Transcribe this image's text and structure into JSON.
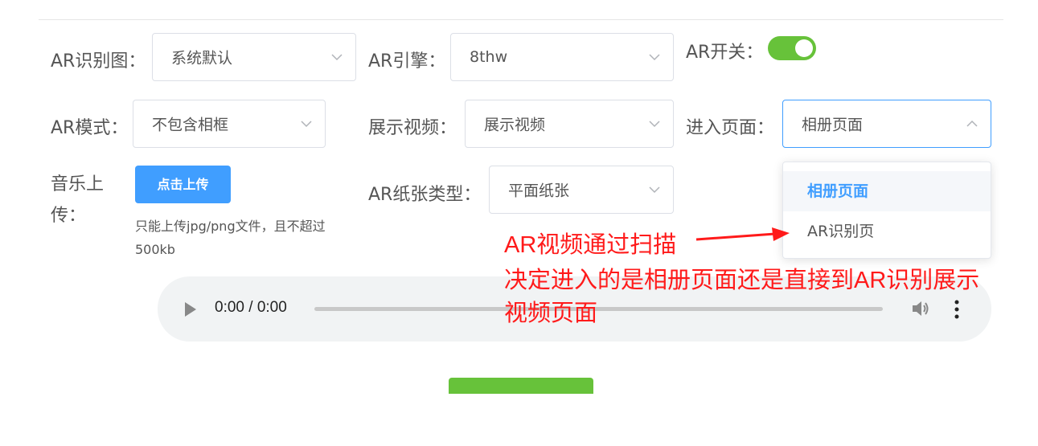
{
  "form": {
    "ar_image": {
      "label": "AR识别图：",
      "value": "系统默认"
    },
    "ar_engine": {
      "label": "AR引擎：",
      "value": "8thw"
    },
    "ar_switch": {
      "label": "AR开关：",
      "checked": true
    },
    "ar_mode": {
      "label": "AR模式：",
      "value": "不包含相框"
    },
    "show_video": {
      "label": "展示视频：",
      "value": "展示视频"
    },
    "enter_page": {
      "label": "进入页面：",
      "value": "相册页面"
    },
    "music_upload": {
      "label_line1": "音乐上",
      "label_line2": "传：",
      "button": "点击上传",
      "tip": "只能上传jpg/png文件，且不超过500kb"
    },
    "paper_type": {
      "label": "AR纸张类型：",
      "value": "平面纸张"
    }
  },
  "dropdown": {
    "options": [
      "相册页面",
      "AR识别页"
    ],
    "selected": "相册页面"
  },
  "audio": {
    "time": "0:00 / 0:00"
  },
  "annotation": {
    "line1": "AR视频通过扫描",
    "line2": "决定进入的是相册页面还是直接到AR识别展示",
    "line3": "视频页面",
    "color": "#ff1a1a"
  },
  "colors": {
    "primary": "#409eff",
    "success": "#67c23a"
  }
}
